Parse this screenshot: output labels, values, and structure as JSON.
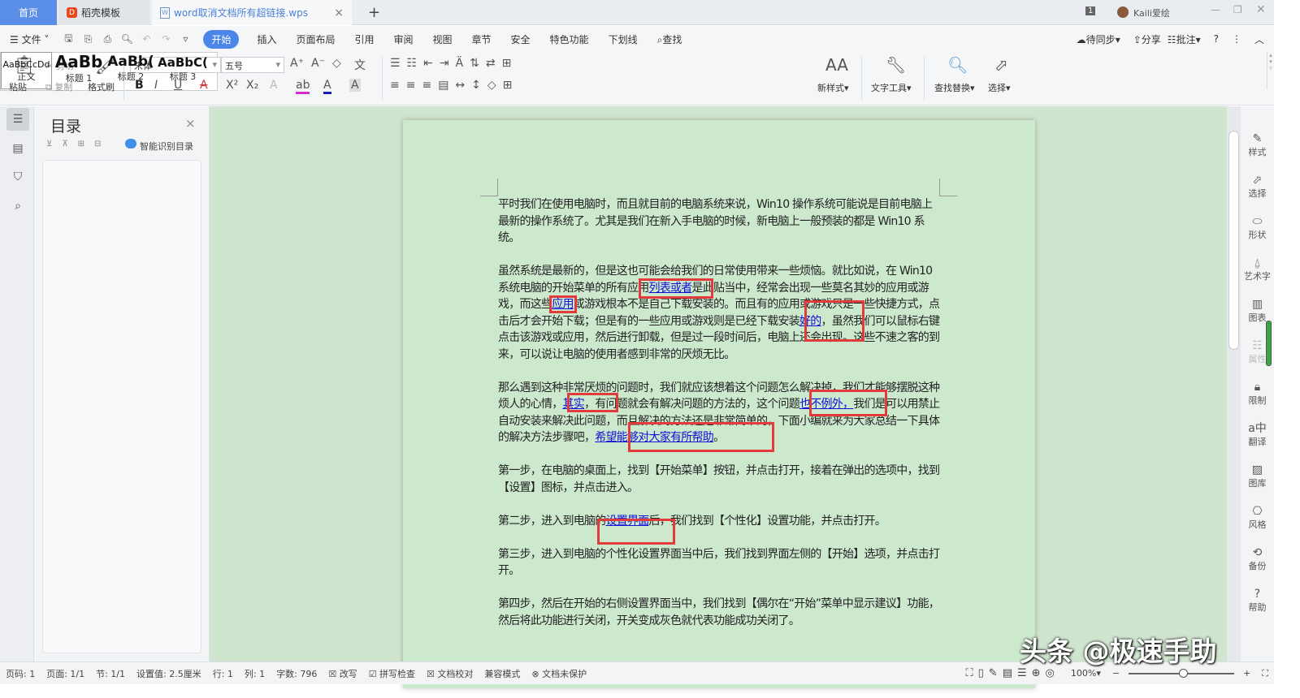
{
  "tabs": {
    "home": "首页",
    "template": "稻壳模板",
    "document": "word取消文档所有超链接.wps",
    "add": "+"
  },
  "titlebar": {
    "badge": "1",
    "user": "Kaili爱绘"
  },
  "menu": {
    "file": "文件",
    "items": [
      "开始",
      "插入",
      "页面布局",
      "引用",
      "审阅",
      "视图",
      "章节",
      "安全",
      "特色功能",
      "下划线"
    ],
    "find": "查找",
    "sync": "待同步",
    "share": "分享",
    "comment": "批注"
  },
  "ribbon": {
    "paste": "粘贴",
    "cut": "剪切",
    "copy": "复制",
    "format_painter": "格式刷",
    "font": "宋体",
    "size": "五号",
    "styles": [
      {
        "preview": "AaBbCcDd",
        "label": "正文"
      },
      {
        "preview": "AaBb",
        "label": "标题 1"
      },
      {
        "preview": "AaBb(",
        "label": "标题 2"
      },
      {
        "preview": "AaBbC(",
        "label": "标题 3"
      }
    ],
    "new_style": "新样式",
    "text_tools": "文字工具",
    "find_replace": "查找替换",
    "select": "选择"
  },
  "toc": {
    "title": "目录",
    "smart": "智能识别目录"
  },
  "document": {
    "paragraphs": [
      [
        {
          "t": "平时我们在使用电脑时，而且就目前的电脑系统来说，Win10 操作系统可能说是目前电脑上最新的操作系统了。尤其是我们在新入手电脑的时候，新电脑上一般预装的都是 Win10 系统。"
        }
      ],
      [
        {
          "t": "虽然系统是最新的，但是这也可能会给我们的日常使用带来一些烦恼。就比如说，在 Win10 系统电脑的开始菜单的所有应用"
        },
        {
          "t": "列表或者",
          "link": true
        },
        {
          "t": "是此贴当中，经常会出现一些莫名其妙的应用或游戏，而这些"
        },
        {
          "t": "应用",
          "link": true
        },
        {
          "t": "或游戏根本不是自己下载安装的。而且有的应用或游戏只是一些快捷方式，点击后才会开始下载；但是有的一些应用或游戏则是已经下载安装"
        },
        {
          "t": "好的",
          "link": true
        },
        {
          "t": "，虽然我们可以鼠标右键点击该游戏或应用，然后进行卸载，但是过一段时间后，电脑上还会出现。这些不速之客的到来，可以说让电脑的使用者感到非常的厌烦无比。"
        }
      ],
      [
        {
          "t": "那么遇到这种非常厌烦的问题时，我们就应该想着这个问题怎么解决掉，我们才能够摆脱这种烦人的心情，"
        },
        {
          "t": "其实",
          "link": true
        },
        {
          "t": "，有问题就会有解决问题的方法的，这个问题"
        },
        {
          "t": "也不例外，",
          "link": true
        },
        {
          "t": "我们是可以用禁止自动安装来解决此问题，而且解决的方法还是非常简单的，下面小编就来为大家总结一下具体的解决方法步骤吧，"
        },
        {
          "t": "希望能够对大家有所帮助",
          "link": true
        },
        {
          "t": "。"
        }
      ],
      [
        {
          "t": "第一步，在电脑的桌面上，找到【开始菜单】按钮，并点击打开，接着在弹出的选项中，找到【设置】图标，并点击进入。"
        }
      ],
      [
        {
          "t": "第二步，进入到电脑的"
        },
        {
          "t": "设置界面",
          "link": true
        },
        {
          "t": "后，我们找到【个性化】设置功能，并点击打开。"
        }
      ],
      [
        {
          "t": "第三步，进入到电脑的个性化设置界面当中后，我们找到界面左侧的【开始】选项，并点击打开。"
        }
      ],
      [
        {
          "t": "第四步，然后在开始的右侧设置界面当中，我们找到【偶尔在“开始”菜单中显示建议】功能，然后将此功能进行关闭，开关变成灰色就代表功能成功关闭了。"
        }
      ]
    ]
  },
  "rightbar": [
    "样式",
    "选择",
    "形状",
    "艺术字",
    "图表",
    "属性",
    "限制",
    "翻译",
    "图库",
    "风格",
    "备份",
    "帮助"
  ],
  "status": {
    "page": "页码: 1",
    "pages": "页面: 1/1",
    "section": "节: 1/1",
    "setting": "设置值: 2.5厘米",
    "row": "行: 1",
    "col": "列: 1",
    "words": "字数: 796",
    "revise": "改写",
    "spell": "拼写检查",
    "proof": "文档校对",
    "compat": "兼容模式",
    "protect": "文档未保护",
    "zoom": "100%"
  },
  "watermark": "头条 @极速手助",
  "colors": {
    "accent": "#4a86e8",
    "link": "#1010d8",
    "highlight_box": "#e23b3b",
    "page_bg": "#cce8cd"
  }
}
